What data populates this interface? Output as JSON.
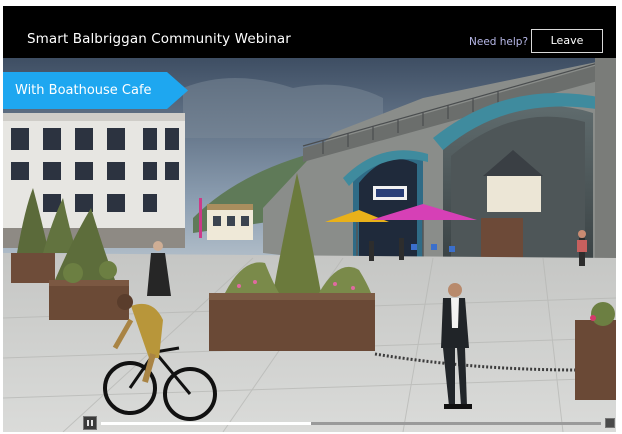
{
  "meeting": {
    "title": "Smart Balbriggan Community Webinar",
    "help_label": "Need help?",
    "leave_label": "Leave"
  },
  "stream": {
    "banner_label": "With Boathouse Cafe",
    "banner_color": "#1ea7f0",
    "progress": 0.42
  },
  "icons": {
    "pause": "pause-icon",
    "volume": "volume-icon"
  }
}
